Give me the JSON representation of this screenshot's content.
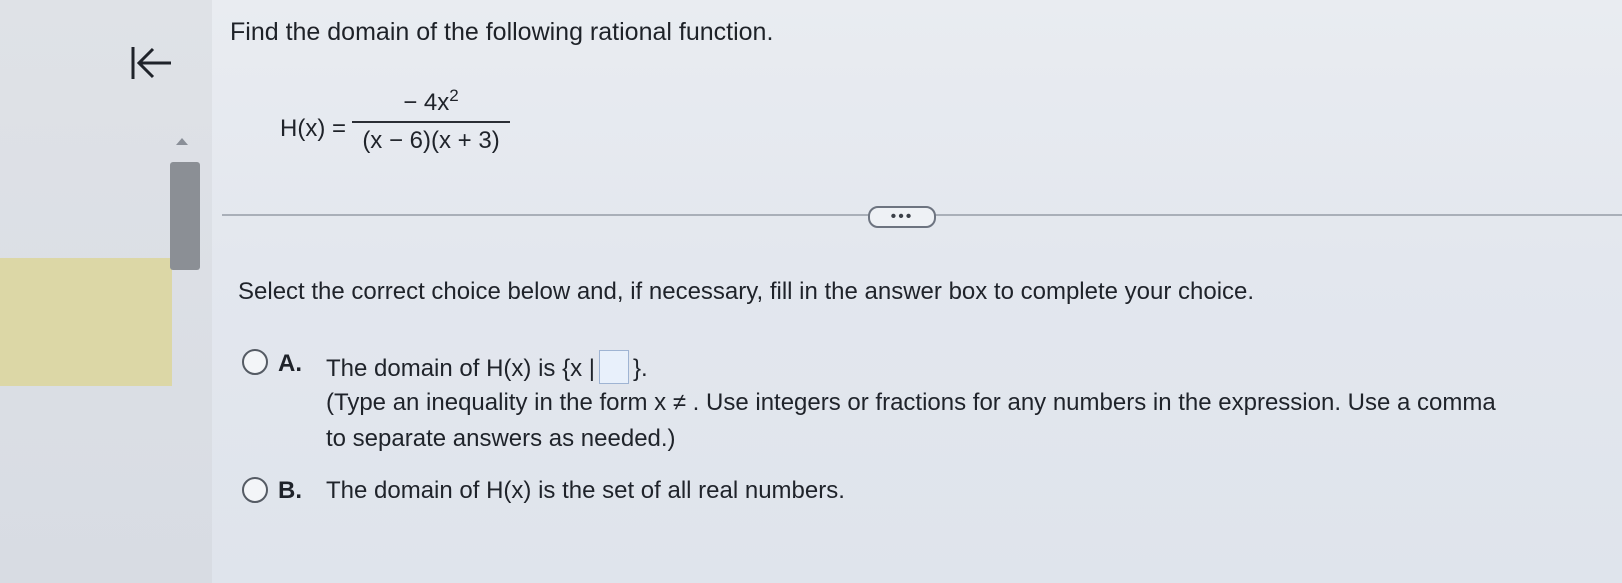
{
  "nav": {
    "back_icon": "back-to-start-icon"
  },
  "question": {
    "text": "Find the domain of the following rational function.",
    "function_label": "H(x) =",
    "numerator": "− 4x",
    "numerator_exponent": "2",
    "denominator": "(x − 6)(x + 3)"
  },
  "more_button": "•••",
  "instructions": "Select the correct choice below and, if necessary, fill in the answer box to complete your choice.",
  "choices": {
    "a": {
      "letter": "A.",
      "text_before": "The domain of H(x) is {x |",
      "answer_value": "",
      "text_after": "}.",
      "note_line1": "(Type an inequality in the form x ≠ . Use integers or fractions for any numbers in the expression. Use a comma",
      "note_line2": "to separate answers as needed.)"
    },
    "b": {
      "letter": "B.",
      "text": "The domain of H(x) is the set of all real numbers."
    }
  },
  "colors": {
    "highlight": "#dcd7a6",
    "answer_box": "#e8f0fb",
    "scroll_thumb": "#8b8f95"
  }
}
